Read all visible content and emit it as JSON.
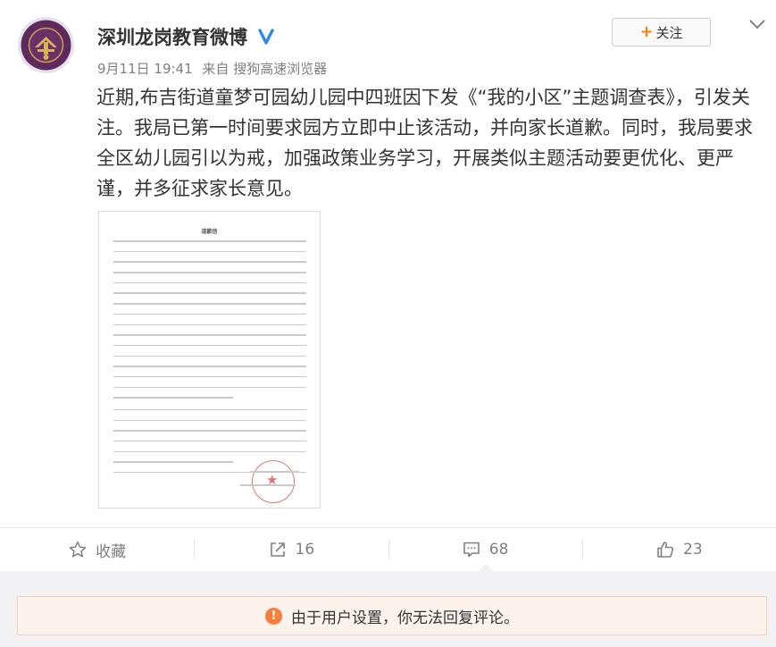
{
  "post": {
    "author": "深圳龙岗教育微博",
    "time": "9月11日 19:41",
    "source_prefix": "来自",
    "source": "搜狗高速浏览器",
    "follow_label": "关注",
    "text": "近期,布吉街道童梦可园幼儿园中四班因下发《“我的小区”主题调查表》，引发关注。我局已第一时间要求园方立即中止该活动，并向家长道歉。同时，我局要求全区幼儿园引以为戒，加强政策业务学习，开展类似主题活动要更优化、更严谨，并多征求家长意见。",
    "image_title": "道歉信"
  },
  "actions": {
    "favorite_label": "收藏",
    "repost_count": "16",
    "comment_count": "68",
    "like_count": "23"
  },
  "notice": {
    "text": "由于用户设置，你无法回复评论。",
    "icon": "!"
  },
  "icons": {
    "verified": "verified-badge-icon",
    "more": "chevron-down-icon",
    "favorite": "star-icon",
    "repost": "share-arrow-icon",
    "comment": "comment-bubble-icon",
    "like": "thumbs-up-icon",
    "notice": "exclamation-icon"
  },
  "colors": {
    "accent": "#ff8200",
    "verified_blue": "#2e8ae6",
    "notice_orange": "#fa7d3c",
    "notice_bg": "#fdf3ec"
  }
}
